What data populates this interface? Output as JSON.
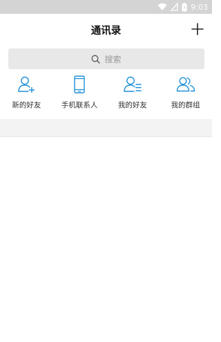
{
  "status_bar": {
    "time": "9:03",
    "icons": [
      "wifi-icon",
      "signal-icon",
      "battery-icon"
    ]
  },
  "header": {
    "title": "通讯录",
    "add_icon": "plus-icon"
  },
  "search": {
    "placeholder": "搜索",
    "icon": "search-icon"
  },
  "quick_actions": [
    {
      "label": "新的好友",
      "icon": "add-friend-icon"
    },
    {
      "label": "手机联系人",
      "icon": "phone-icon"
    },
    {
      "label": "我的好友",
      "icon": "friends-list-icon"
    },
    {
      "label": "我的群组",
      "icon": "group-icon"
    }
  ],
  "colors": {
    "accent": "#1e8fd8",
    "status_bar": "#d4d4d4",
    "search_bg": "#e8e8e8"
  }
}
